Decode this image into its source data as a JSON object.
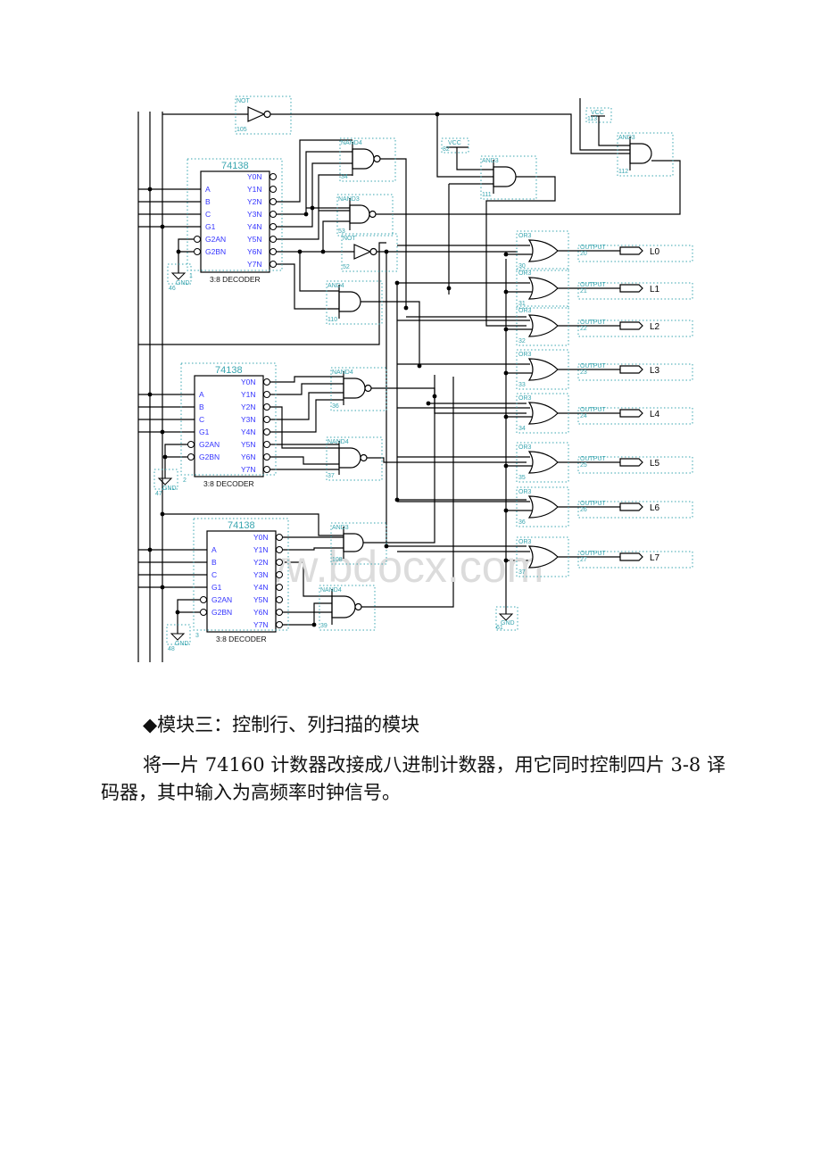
{
  "schematic": {
    "watermark": "www.bdocx.com",
    "decoders": [
      {
        "part": "74138",
        "footer": "3:8 DECODER",
        "instance": "1",
        "inputs": [
          "A",
          "B",
          "C",
          "G1",
          "G2AN",
          "G2BN"
        ],
        "outputs": [
          "Y0N",
          "Y1N",
          "Y2N",
          "Y3N",
          "Y4N",
          "Y5N",
          "Y6N",
          "Y7N"
        ]
      },
      {
        "part": "74138",
        "footer": "3:8 DECODER",
        "instance": "2",
        "inputs": [
          "A",
          "B",
          "C",
          "G1",
          "G2AN",
          "G2BN"
        ],
        "outputs": [
          "Y0N",
          "Y1N",
          "Y2N",
          "Y3N",
          "Y4N",
          "Y5N",
          "Y6N",
          "Y7N"
        ]
      },
      {
        "part": "74138",
        "footer": "3:8 DECODER",
        "instance": "3",
        "inputs": [
          "A",
          "B",
          "C",
          "G1",
          "G2AN",
          "G2BN"
        ],
        "outputs": [
          "Y0N",
          "Y1N",
          "Y2N",
          "Y3N",
          "Y4N",
          "Y5N",
          "Y6N",
          "Y7N"
        ]
      }
    ],
    "gates": [
      {
        "type": "NOT",
        "id": "105"
      },
      {
        "type": "NAND4",
        "id": "34"
      },
      {
        "type": "NAND3",
        "id": "53"
      },
      {
        "type": "NOT",
        "id": "52"
      },
      {
        "type": "AND4",
        "id": "110"
      },
      {
        "type": "AND3",
        "id": "111"
      },
      {
        "type": "AND3",
        "id": "112"
      },
      {
        "type": "NAND4",
        "id": "36"
      },
      {
        "type": "NAND4",
        "id": "37"
      },
      {
        "type": "AND3",
        "id": "108"
      },
      {
        "type": "NAND4",
        "id": "39"
      }
    ],
    "or_gates": [
      {
        "type": "OR3",
        "id": "30"
      },
      {
        "type": "OR3",
        "id": "31"
      },
      {
        "type": "OR3",
        "id": "32"
      },
      {
        "type": "OR3",
        "id": "33"
      },
      {
        "type": "OR3",
        "id": "34"
      },
      {
        "type": "OR3",
        "id": "35"
      },
      {
        "type": "OR3",
        "id": "36"
      },
      {
        "type": "OR3",
        "id": "37"
      }
    ],
    "outputs": [
      {
        "type": "OUTPUT",
        "id": "20",
        "name": "L0"
      },
      {
        "type": "OUTPUT",
        "id": "21",
        "name": "L1"
      },
      {
        "type": "OUTPUT",
        "id": "22",
        "name": "L2"
      },
      {
        "type": "OUTPUT",
        "id": "23",
        "name": "L3"
      },
      {
        "type": "OUTPUT",
        "id": "24",
        "name": "L4"
      },
      {
        "type": "OUTPUT",
        "id": "25",
        "name": "L5"
      },
      {
        "type": "OUTPUT",
        "id": "26",
        "name": "L6"
      },
      {
        "type": "OUTPUT",
        "id": "27",
        "name": "L7"
      }
    ],
    "power": [
      {
        "type": "VCC",
        "id": "82"
      },
      {
        "type": "VCC",
        "id": "113"
      },
      {
        "type": "GND",
        "id": "46"
      },
      {
        "type": "GND",
        "id": "47"
      },
      {
        "type": "GND",
        "id": "48"
      },
      {
        "type": "GND",
        "id": "61"
      }
    ],
    "colors": {
      "wire": "#000000",
      "pin_label": "#3333ff",
      "component_label": "#3aa6b0",
      "frame": "#3aa6b0"
    }
  },
  "text": {
    "heading": "◆模块三：控制行、列扫描的模块",
    "paragraph": "将一片 74160 计数器改接成八进制计数器，用它同时控制四片 3-8 译码器，其中输入为高频率时钟信号。"
  }
}
